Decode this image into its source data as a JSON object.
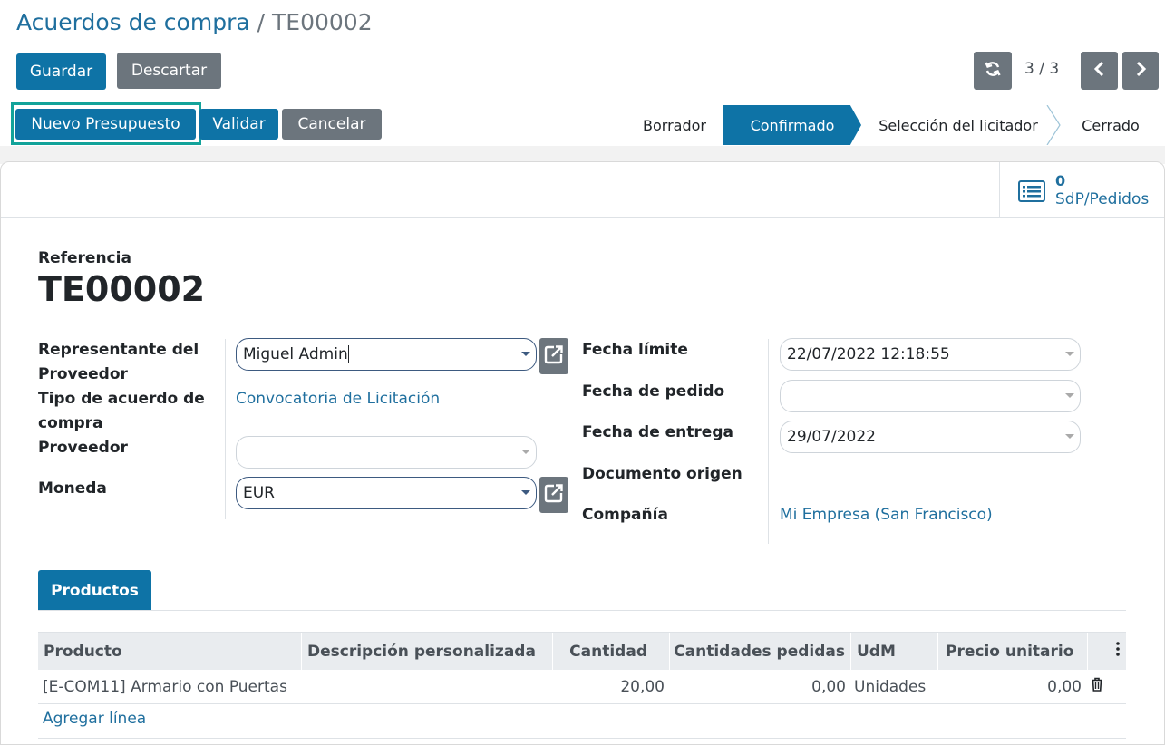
{
  "breadcrumb": {
    "parent": "Acuerdos de compra",
    "separator": " / ",
    "current": "TE00002"
  },
  "toolbar": {
    "save_label": "Guardar",
    "discard_label": "Descartar"
  },
  "pager": {
    "value": "3 / 3",
    "refresh_icon": "refresh-icon",
    "prev_icon": "chevron-left-icon",
    "next_icon": "chevron-right-icon"
  },
  "actions": {
    "new_quotation": "Nuevo Presupuesto",
    "validate": "Validar",
    "cancel": "Cancelar"
  },
  "statusbar": {
    "steps": [
      "Borrador",
      "Confirmado",
      "Selección del licitador",
      "Cerrado"
    ],
    "active": "Confirmado"
  },
  "smart_button": {
    "count": "0",
    "label": "SdP/Pedidos",
    "icon": "list-icon"
  },
  "form": {
    "reference_label": "Referencia",
    "reference": "TE00002",
    "left": {
      "representative_label_1": "Representante del",
      "representative_label_2": "Proveedor",
      "representative_value": "Miguel Admin",
      "agreement_type_label_1": "Tipo de acuerdo de",
      "agreement_type_label_2": "compra",
      "agreement_type_value": "Convocatoria de Licitación",
      "vendor_label": "Proveedor",
      "vendor_value": "",
      "currency_label": "Moneda",
      "currency_value": "EUR"
    },
    "right": {
      "deadline_label": "Fecha límite",
      "deadline_value": "22/07/2022 12:18:55",
      "order_date_label": "Fecha de pedido",
      "order_date_value": "",
      "delivery_date_label": "Fecha de entrega",
      "delivery_date_value": "29/07/2022",
      "source_doc_label": "Documento origen",
      "company_label": "Compañía",
      "company_value": "Mi Empresa (San Francisco)"
    }
  },
  "tabs": [
    {
      "label": "Productos"
    }
  ],
  "table": {
    "headers": [
      "Producto",
      "Descripción personalizada",
      "Cantidad",
      "Cantidades pedidas",
      "UdM",
      "Precio unitario"
    ],
    "rows": [
      {
        "product": "[E-COM11] Armario con Puertas",
        "description": "",
        "quantity": "20,00",
        "ordered": "0,00",
        "uom": "Unidades",
        "price": "0,00"
      }
    ],
    "add_line": "Agregar línea"
  },
  "colors": {
    "primary": "#0e73a6",
    "secondary": "#6c757d",
    "link": "#1f6f9e",
    "highlight": "#12a39a"
  }
}
